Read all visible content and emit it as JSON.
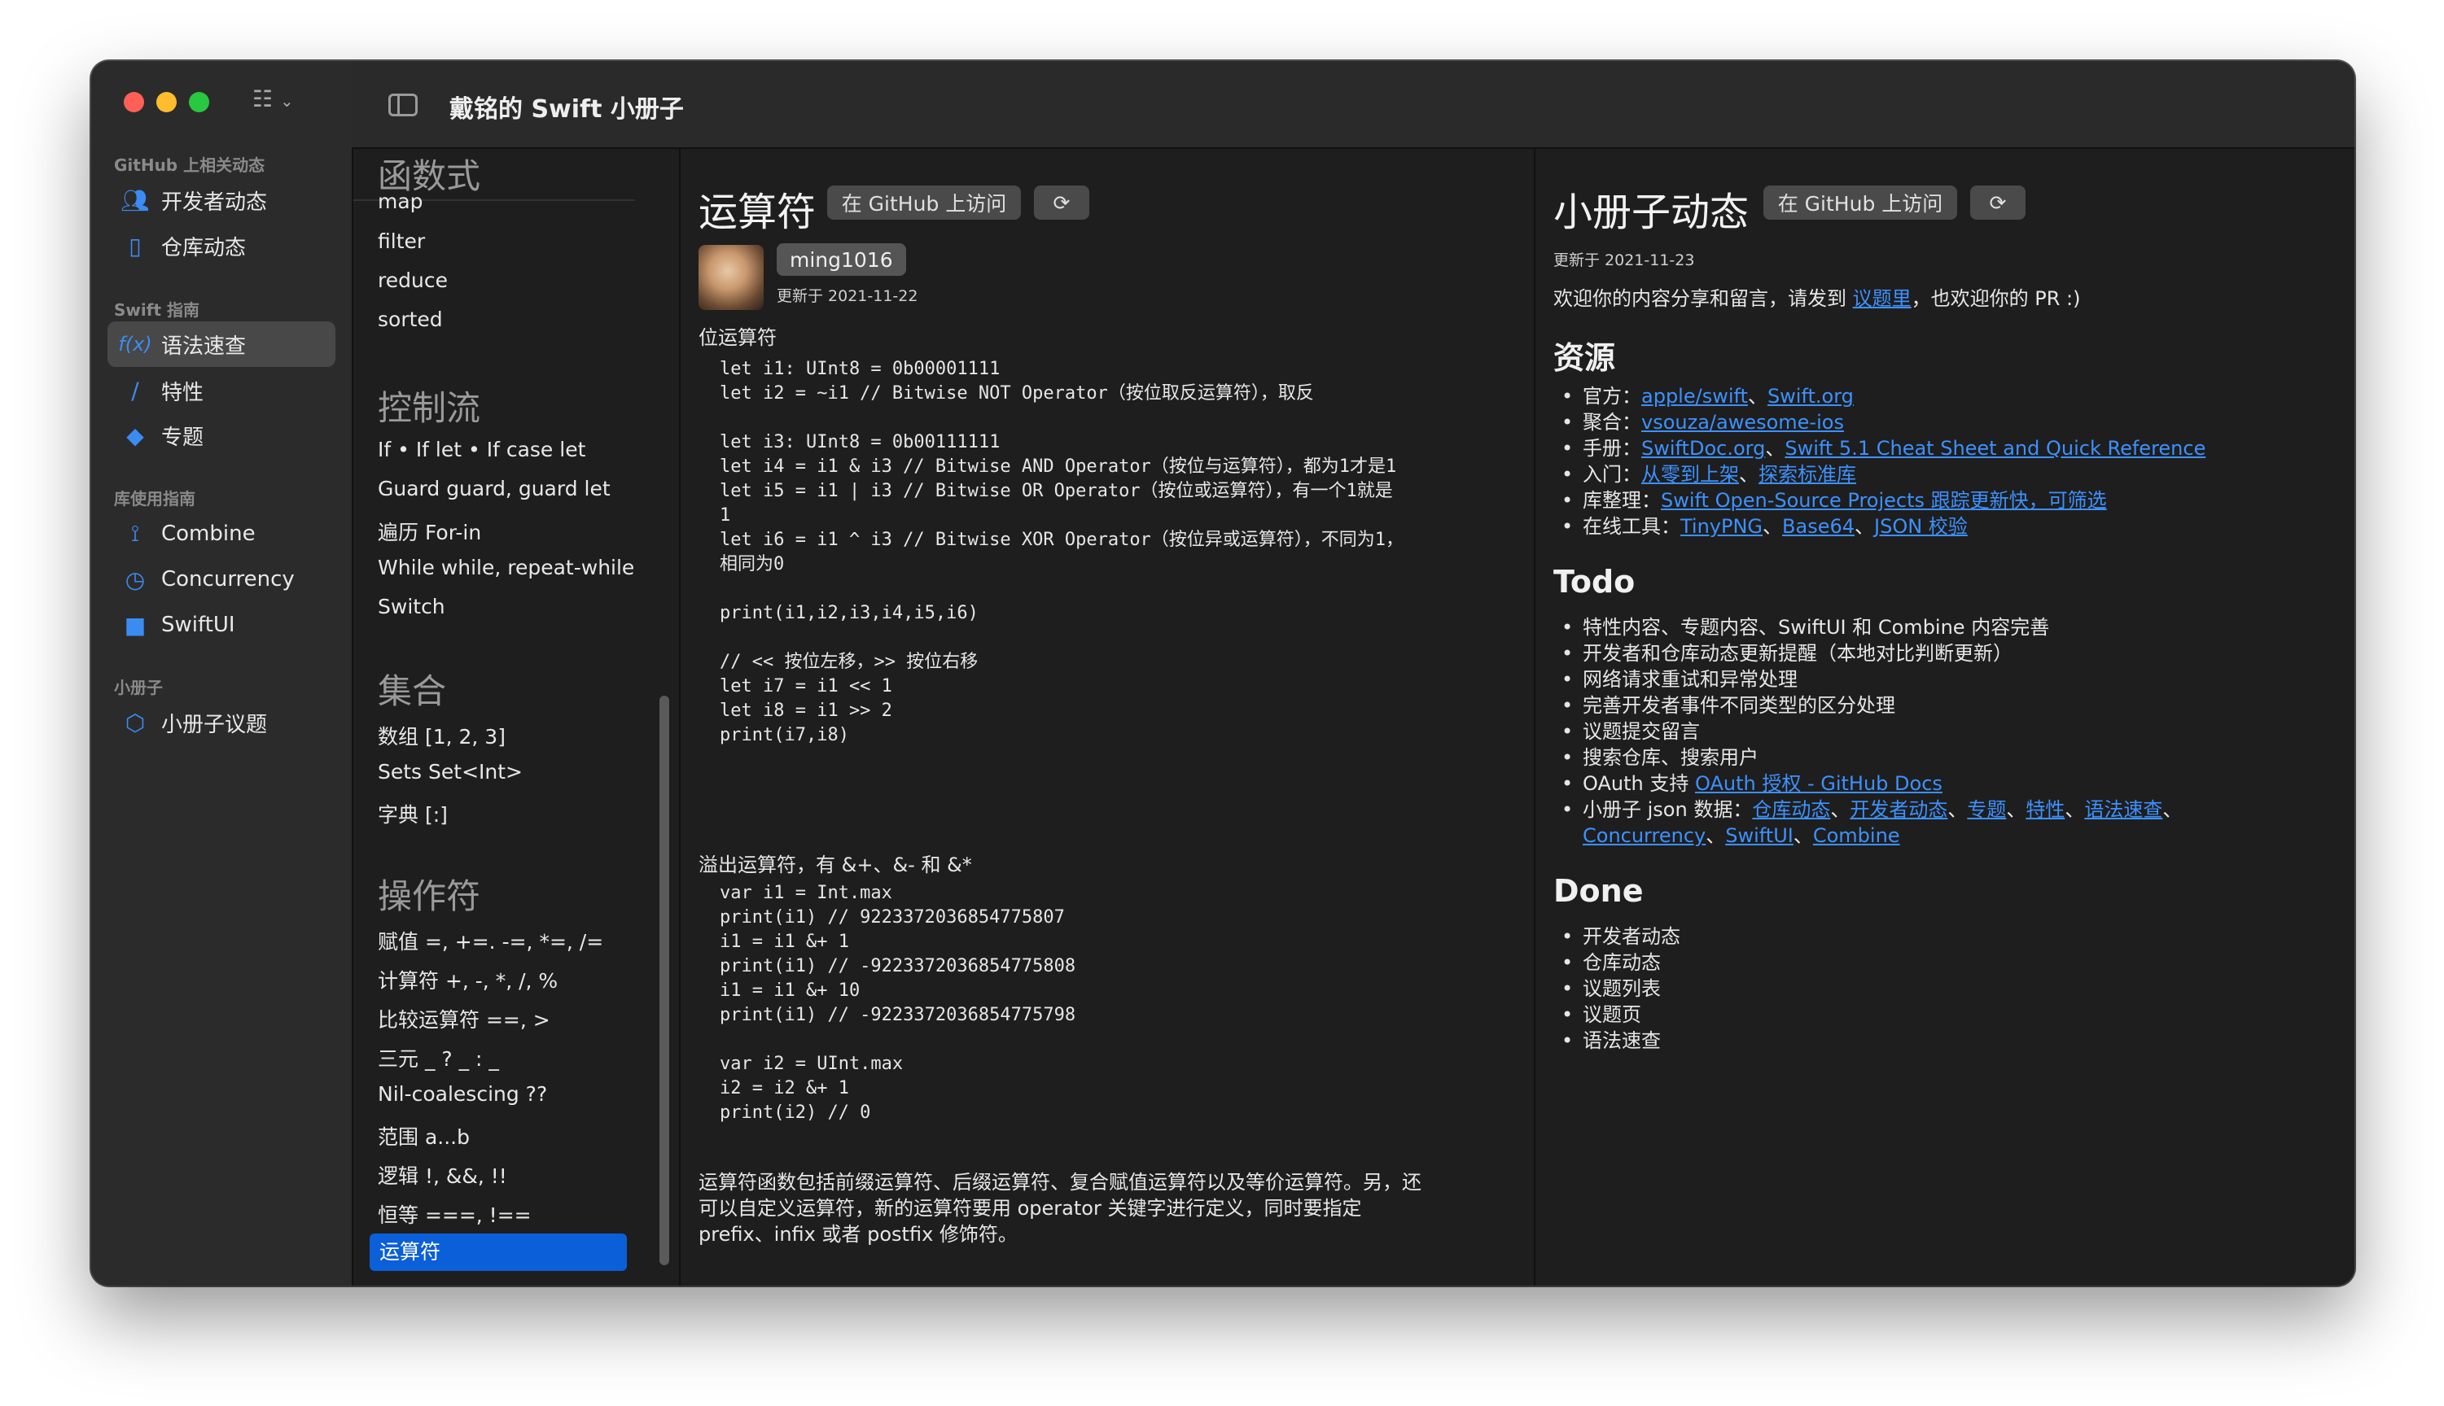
{
  "window": {
    "title": "戴铭的 Swift 小册子"
  },
  "sidebar": {
    "sections": [
      {
        "label": "GitHub 上相关动态"
      },
      {
        "label": "Swift 指南"
      },
      {
        "label": "库使用指南"
      },
      {
        "label": "小册子"
      }
    ],
    "items": [
      {
        "label": "开发者动态",
        "icon": "people-icon"
      },
      {
        "label": "仓库动态",
        "icon": "book-icon"
      },
      {
        "label": "语法速查",
        "icon": "function-icon",
        "active": true
      },
      {
        "label": "特性",
        "icon": "pencil-icon"
      },
      {
        "label": "专题",
        "icon": "graduation-cap-icon"
      },
      {
        "label": "Combine",
        "icon": "combine-icon"
      },
      {
        "label": "Concurrency",
        "icon": "clock-arrow-icon"
      },
      {
        "label": "SwiftUI",
        "icon": "swiftui-icon"
      },
      {
        "label": "小册子议题",
        "icon": "cube-icon"
      }
    ]
  },
  "list": {
    "groups": [
      {
        "header": "函数式",
        "items": [
          "map",
          "filter",
          "reduce",
          "sorted"
        ]
      },
      {
        "header": "控制流",
        "items": [
          "If • If let • If case let",
          "Guard guard, guard let",
          "遍历 For-in",
          "While while, repeat-while",
          "Switch"
        ]
      },
      {
        "header": "集合",
        "items": [
          "数组 [1, 2, 3]",
          "Sets Set<Int>",
          "字典 [:]"
        ]
      },
      {
        "header": "操作符",
        "items": [
          "赋值 =, +=. -=, *=, /=",
          "计算符 +, -, *, /, %",
          "比较运算符 ==, >",
          "三元 _ ? _ : _",
          "Nil-coalescing ??",
          "范围 a...b",
          "逻辑 !, &&, !!",
          "恒等 ===, !==",
          "运算符"
        ]
      }
    ],
    "selected": "运算符"
  },
  "detail": {
    "title": "运算符",
    "github_button": "在 GitHub 上访问",
    "refresh_icon": "refresh-icon",
    "author": "ming1016",
    "updated": "更新于 2021-11-22",
    "subtitle": "位运算符",
    "code1": "let i1: UInt8 = 0b00001111\nlet i2 = ~i1 // Bitwise NOT Operator（按位取反运算符），取反\n\nlet i3: UInt8 = 0b00111111\nlet i4 = i1 & i3 // Bitwise AND Operator（按位与运算符），都为1才是1\nlet i5 = i1 | i3 // Bitwise OR Operator（按位或运算符），有一个1就是\n1\nlet i6 = i1 ^ i3 // Bitwise XOR Operator（按位异或运算符），不同为1，\n相同为0\n\nprint(i1,i2,i3,i4,i5,i6)\n\n// << 按位左移，>> 按位右移\nlet i7 = i1 << 1\nlet i8 = i1 >> 2\nprint(i7,i8)",
    "overflow_text": "溢出运算符，有 &+、&- 和 &*",
    "code2": "var i1 = Int.max\nprint(i1) // 9223372036854775807\ni1 = i1 &+ 1\nprint(i1) // -9223372036854775808\ni1 = i1 &+ 10\nprint(i1) // -9223372036854775798\n\nvar i2 = UInt.max\ni2 = i2 &+ 1\nprint(i2) // 0",
    "para_lines": [
      "运算符函数包括前缀运算符、后缀运算符、复合赋值运算符以及等价运算符。另，还",
      "可以自定义运算符，新的运算符要用 operator 关键字进行定义，同时要指定",
      "prefix、infix 或者 postfix 修饰符。"
    ]
  },
  "news": {
    "title": "小册子动态",
    "github_button": "在 GitHub 上访问",
    "updated": "更新于 2021-11-23",
    "welcome_prefix": "欢迎你的内容分享和留言，请发到 ",
    "welcome_link": "议题里",
    "welcome_suffix": "，也欢迎你的 PR :)",
    "resources_title": "资源",
    "resources": [
      {
        "prefix": "官方：",
        "links": [
          "apple/swift",
          "Swift.org"
        ]
      },
      {
        "prefix": "聚合：",
        "links": [
          "vsouza/awesome-ios"
        ]
      },
      {
        "prefix": "手册：",
        "links": [
          "SwiftDoc.org",
          "Swift 5.1 Cheat Sheet and Quick Reference"
        ]
      },
      {
        "prefix": "入门：",
        "links": [
          "从零到上架",
          "探索标准库"
        ]
      },
      {
        "prefix": "库整理：",
        "links": [
          "Swift Open-Source Projects 跟踪更新快，可筛选"
        ]
      },
      {
        "prefix": "在线工具：",
        "links": [
          "TinyPNG",
          "Base64",
          "JSON 校验"
        ]
      }
    ],
    "todo_title": "Todo",
    "todo": [
      "特性内容、专题内容、SwiftUI 和 Combine 内容完善",
      "开发者和仓库动态更新提醒（本地对比判断更新）",
      "网络请求重试和异常处理",
      "完善开发者事件不同类型的区分处理",
      "议题提交留言",
      "搜索仓库、搜索用户"
    ],
    "todo_oauth_prefix": "OAuth 支持 ",
    "todo_oauth_link": "OAuth 授权 - GitHub Docs",
    "todo_json_prefix": "小册子 json 数据：",
    "todo_json_links_line1": [
      "仓库动态",
      "开发者动态",
      "专题",
      "特性",
      "语法速查"
    ],
    "todo_json_links_line2": [
      "Concurrency",
      "SwiftUI",
      "Combine"
    ],
    "done_title": "Done",
    "done": [
      "开发者动态",
      "仓库动态",
      "议题列表",
      "议题页",
      "语法速查"
    ]
  }
}
